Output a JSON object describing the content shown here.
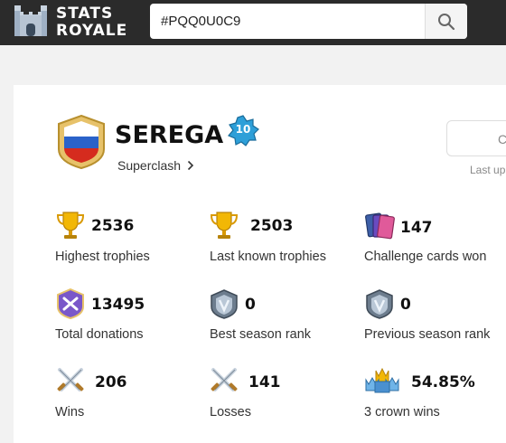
{
  "app": {
    "logo_text_line1": "STATS",
    "logo_text_line2": "ROYALE"
  },
  "search": {
    "value": "#PQQ0U0C9"
  },
  "player": {
    "name": "SEREGA",
    "level": "10",
    "clan": "Superclash"
  },
  "side": {
    "partial_button_char": "C",
    "last_updated_partial": "Last up"
  },
  "stats": [
    {
      "icon": "trophy-icon",
      "value": "2536",
      "label": "Highest trophies"
    },
    {
      "icon": "trophy-icon",
      "value": "2503",
      "label": "Last known trophies"
    },
    {
      "icon": "cards-icon",
      "value": "147",
      "label": "Challenge cards won"
    },
    {
      "icon": "donation-badge-icon",
      "value": "13495",
      "label": "Total donations"
    },
    {
      "icon": "season-rank-shield-icon",
      "value": "0",
      "label": "Best season rank"
    },
    {
      "icon": "season-rank-shield-icon",
      "value": "0",
      "label": "Previous season rank"
    },
    {
      "icon": "crossed-swords-icon",
      "value": "206",
      "label": "Wins"
    },
    {
      "icon": "crossed-swords-icon",
      "value": "141",
      "label": "Losses"
    },
    {
      "icon": "three-crowns-icon",
      "value": "54.85%",
      "label": "3 crown wins"
    }
  ],
  "colors": {
    "topbar": "#2b2b2b",
    "trophy_gold": "#f2b705",
    "level_badge": "#2e9fd8",
    "shield_purple": "#7a57c9"
  }
}
